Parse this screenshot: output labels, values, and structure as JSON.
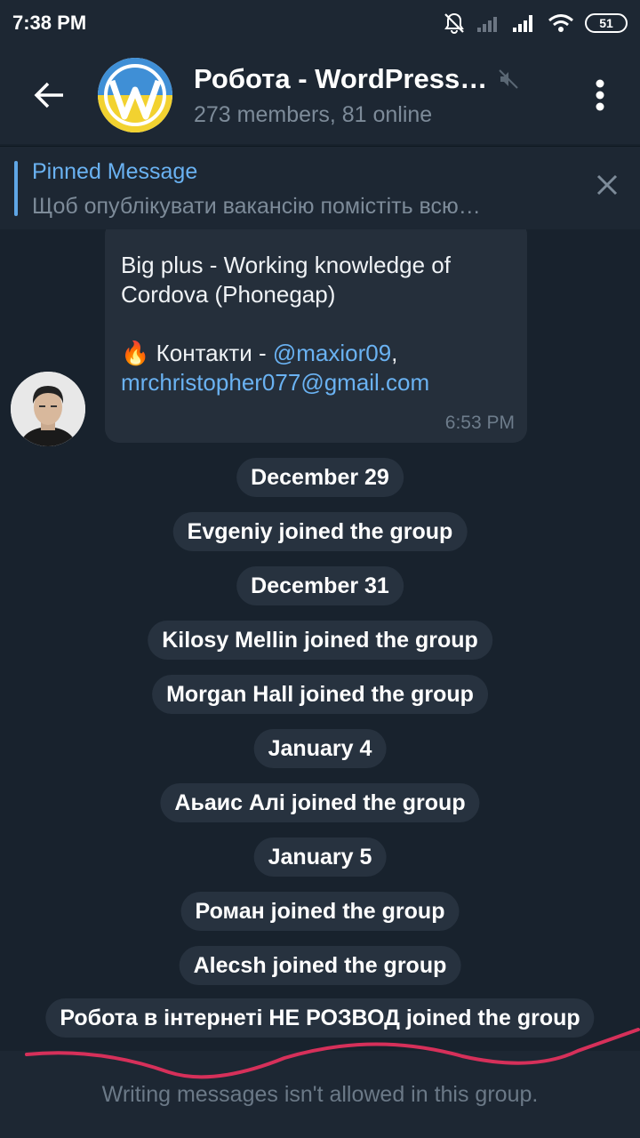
{
  "status_bar": {
    "time": "7:38 PM",
    "battery": "51"
  },
  "header": {
    "title": "Робота - WordPress…",
    "subtitle": "273 members, 81 online"
  },
  "pinned": {
    "title": "Pinned Message",
    "body": "Щоб опублікувати вакансію помістіть всю…"
  },
  "message": {
    "line1": "Big plus - Working knowledge of",
    "line2": "Cordova (Phonegap)",
    "emoji": "🔥",
    "contacts_label": " Контакти - ",
    "handle": "@maxior09",
    "comma": ",",
    "email": "mrchristopher077@gmail.com",
    "time": "6:53 PM"
  },
  "service_messages": [
    {
      "text": "December 29"
    },
    {
      "text": "Evgeniy joined the group"
    },
    {
      "text": "December 31"
    },
    {
      "text": "Kilosy Mellin joined the group"
    },
    {
      "text": "Morgan Hall joined the group"
    },
    {
      "text": "January 4"
    },
    {
      "text": "Аьаис Алі joined the group"
    },
    {
      "text": "January 5"
    },
    {
      "text": "Роман joined the group"
    },
    {
      "text": "Alecsh joined the group"
    },
    {
      "text": "Робота в інтернеті НЕ РОЗВОД joined the group"
    }
  ],
  "bottom": {
    "text": "Writing messages isn't allowed in this group."
  },
  "colors": {
    "background": "#18222d",
    "header": "#1d2733",
    "bubble": "#252f3b",
    "link": "#6ab2f2",
    "annotation": "#d6305a"
  },
  "icons": [
    "back-arrow-icon",
    "mute-icon",
    "more-vertical-icon",
    "close-icon",
    "mute-notifications-icon",
    "signal-icon",
    "wifi-icon"
  ]
}
